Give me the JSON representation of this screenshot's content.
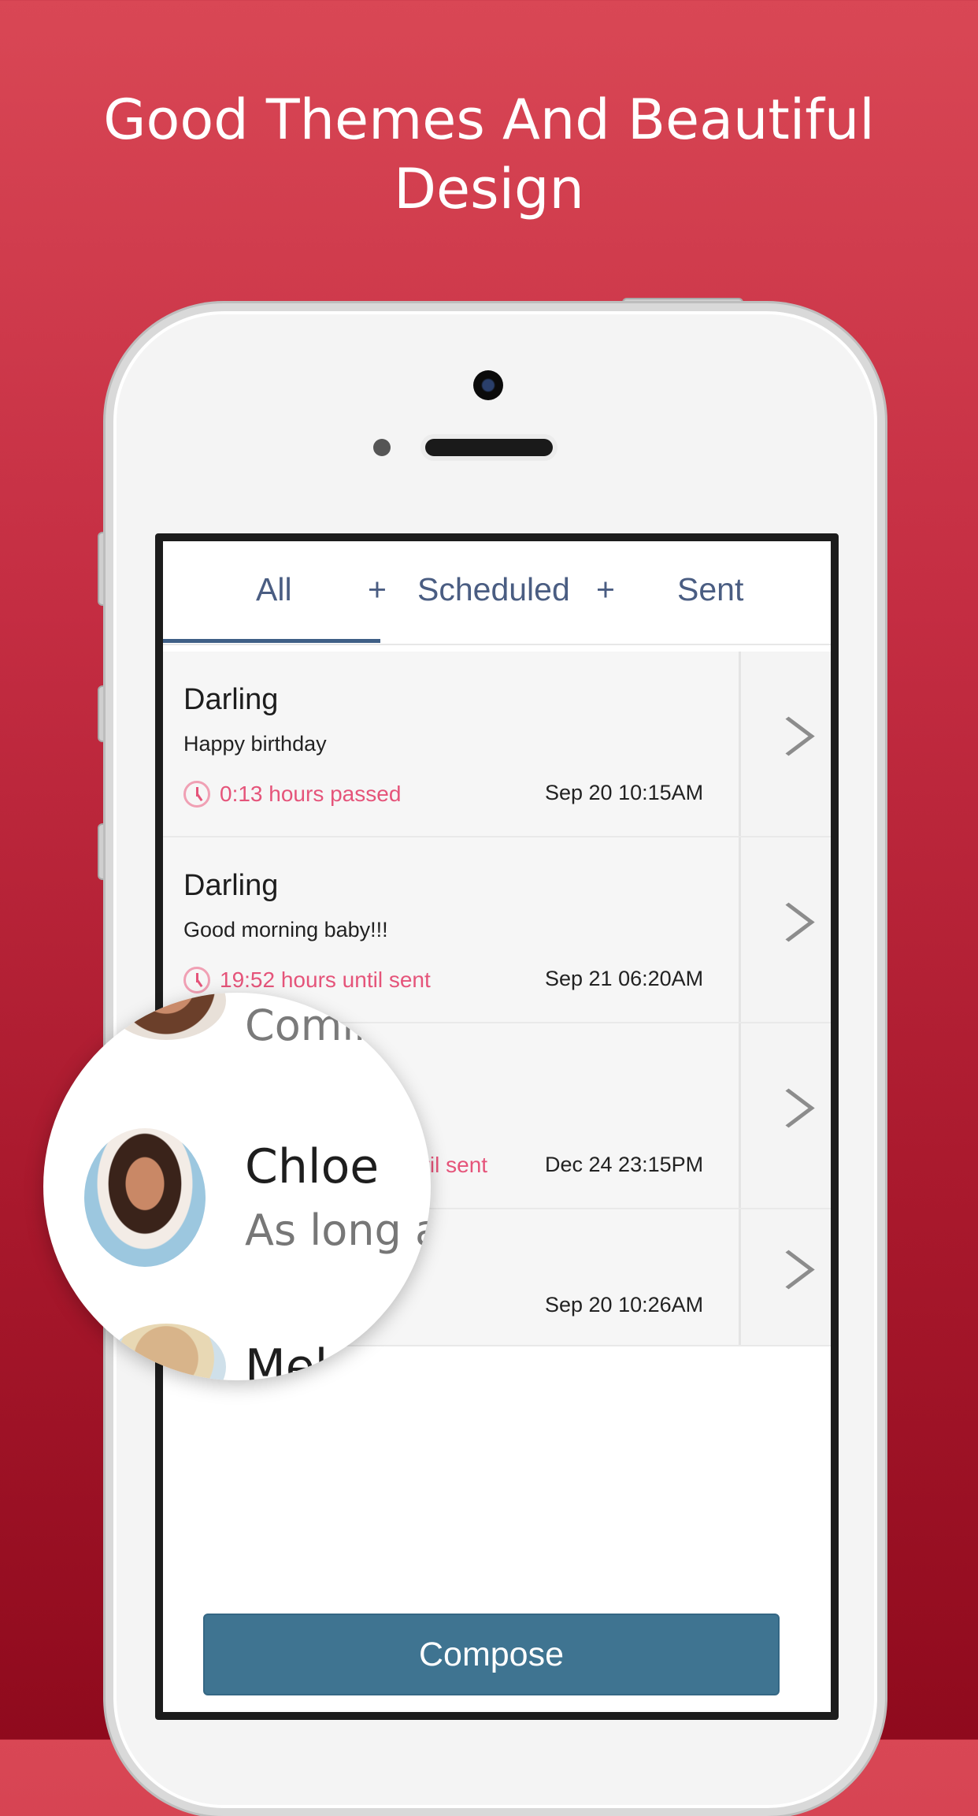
{
  "headline": {
    "line1": "Good Themes And Beautiful",
    "line2": "Design"
  },
  "tabs": {
    "all": "All",
    "plus": "+",
    "scheduled": "Scheduled",
    "sent": "Sent"
  },
  "messages": [
    {
      "name": "Darling",
      "text": "Happy birthday",
      "status": "0:13 hours passed",
      "time": "Sep 20 10:15AM"
    },
    {
      "name": "Darling",
      "text": "Good morning baby!!!",
      "status": "19:52 hours until sent",
      "time": "Sep 21 06:20AM"
    },
    {
      "name": "",
      "text": "",
      "status": "until sent",
      "time": "Dec 24 23:15PM"
    },
    {
      "name": "",
      "text": "",
      "status": "",
      "time": "Sep 20 10:26AM"
    }
  ],
  "compose": "Compose",
  "magnifier": {
    "top_text": "Comin",
    "name": "Chloe",
    "subtext": "As long as",
    "bottom_text": "Mel"
  },
  "colors": {
    "background": "#c42d42",
    "accent": "#3f7491",
    "status": "#e5547a"
  }
}
